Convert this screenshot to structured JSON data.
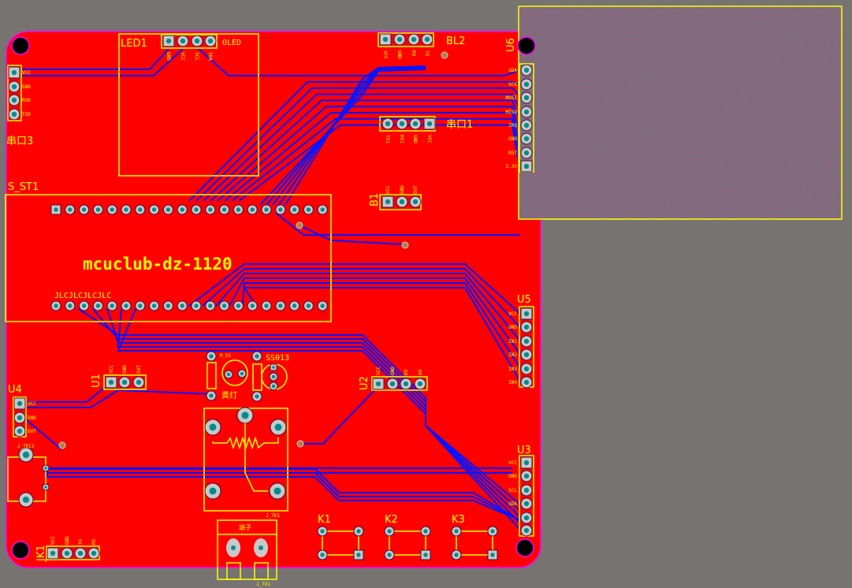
{
  "colors": {
    "background": "#767371",
    "board": "#ff0000",
    "silkscreen": "#ffff00",
    "trace": "#0a14ff",
    "outline": "#ff00ff",
    "pad": "#c8c8c8",
    "drill": "#008c8c"
  },
  "board_text": {
    "title": "mcuclub-dz-1120",
    "jlc": "JLCJLCJLCJLC"
  },
  "components": {
    "uart3": {
      "ref": "串口3",
      "pins": [
        "VCC",
        "GND",
        "RXD",
        "TXD"
      ]
    },
    "led1": {
      "ref": "LED1",
      "value": "OLED",
      "pins": [
        "GND",
        "VCC",
        "SCL",
        "SDA"
      ]
    },
    "bl2": {
      "ref": "BL2",
      "pins": [
        "VCC",
        "GND",
        "RX",
        "TX"
      ]
    },
    "uart1": {
      "ref": "串口1",
      "pins": [
        "TX1",
        "RX1",
        "GND",
        "VCC"
      ]
    },
    "u6": {
      "ref": "U6",
      "pins": [
        "SDA",
        "SCK",
        "MOSI",
        "MISO",
        "IRQ",
        "GND",
        "RST",
        "3.3V"
      ]
    },
    "b1": {
      "ref": "B1",
      "pins": [
        "VCC",
        "GND",
        "OUT"
      ]
    },
    "s_st1": {
      "ref": "S_ST1"
    },
    "u5": {
      "ref": "U5",
      "pins": [
        "VCC",
        "GND",
        "IN1",
        "IN2",
        "IN3",
        "IN4"
      ]
    },
    "u3": {
      "ref": "U3",
      "pins": [
        "VCC",
        "GND",
        "SCL",
        "SDA"
      ]
    },
    "u1": {
      "ref": "U1",
      "pins": [
        "VCC",
        "GND",
        "OUT"
      ]
    },
    "u4": {
      "ref": "U4",
      "pins": [
        "VCC",
        "GND",
        "OUT"
      ]
    },
    "u2": {
      "ref": "U2",
      "pins": [
        "VCC",
        "GND",
        "DO",
        "AO"
      ]
    },
    "jtec1": {
      "ref": "J_TEC1"
    },
    "jk1": {
      "ref": "JK1",
      "pins": [
        "VCC",
        "GND",
        "TX",
        "RX"
      ]
    },
    "rd1": {
      "ref": "R_D1"
    },
    "led_yellow": {
      "ref": "黄灯"
    },
    "ss013": {
      "ref": "SS013"
    },
    "relay": {
      "ref": "J_TK1"
    },
    "terminal": {
      "ref": "端子",
      "sub": "J_TO1"
    },
    "k1": {
      "ref": "K1"
    },
    "k2": {
      "ref": "K2"
    },
    "k3": {
      "ref": "K3"
    }
  }
}
